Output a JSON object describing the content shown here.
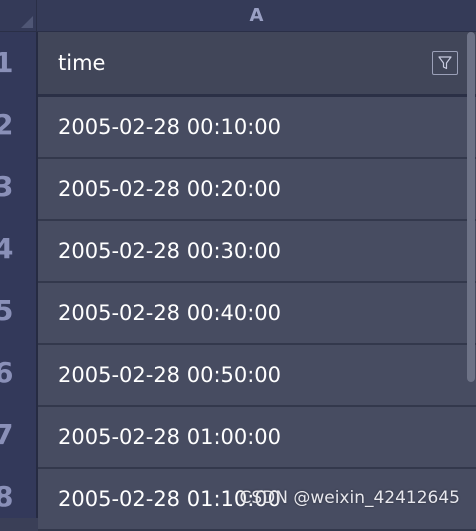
{
  "column_header": "A",
  "header_row": {
    "row_number": "1",
    "label": "time"
  },
  "rows": [
    {
      "row_number": "2",
      "value": "2005-02-28 00:10:00"
    },
    {
      "row_number": "3",
      "value": "2005-02-28 00:20:00"
    },
    {
      "row_number": "4",
      "value": "2005-02-28 00:30:00"
    },
    {
      "row_number": "5",
      "value": "2005-02-28 00:40:00"
    },
    {
      "row_number": "6",
      "value": "2005-02-28 00:50:00"
    },
    {
      "row_number": "7",
      "value": "2005-02-28 01:00:00"
    },
    {
      "row_number": "8",
      "value": "2005-02-28 01:10:00"
    }
  ],
  "icons": {
    "filter": "filter-icon"
  },
  "watermark": "CSDN @weixin_42412645"
}
